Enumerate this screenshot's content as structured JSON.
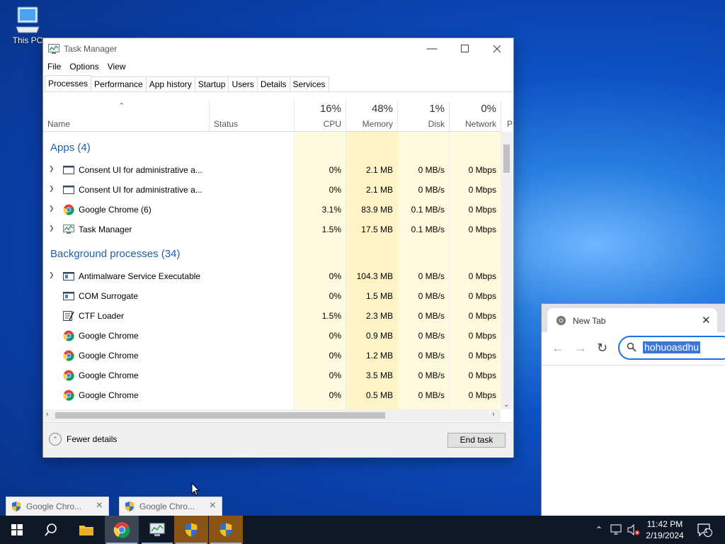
{
  "desktop": {
    "this_pc_label": "This PC"
  },
  "task_manager": {
    "title": "Task Manager",
    "menu": [
      "File",
      "Options",
      "View"
    ],
    "tabs": [
      "Processes",
      "Performance",
      "App history",
      "Startup",
      "Users",
      "Details",
      "Services"
    ],
    "columns": {
      "name": "Name",
      "status": "Status",
      "cpu": {
        "pct": "16%",
        "label": "CPU"
      },
      "memory": {
        "pct": "48%",
        "label": "Memory"
      },
      "disk": {
        "pct": "1%",
        "label": "Disk"
      },
      "network": {
        "pct": "0%",
        "label": "Network"
      },
      "power_partial": "P"
    },
    "groups": {
      "apps": "Apps (4)",
      "background": "Background processes (34)"
    },
    "apps": [
      {
        "name": "Consent UI for administrative a...",
        "cpu": "0%",
        "memory": "2.1 MB",
        "disk": "0 MB/s",
        "network": "0 Mbps",
        "icon": "window-icon"
      },
      {
        "name": "Consent UI for administrative a...",
        "cpu": "0%",
        "memory": "2.1 MB",
        "disk": "0 MB/s",
        "network": "0 Mbps",
        "icon": "window-icon"
      },
      {
        "name": "Google Chrome (6)",
        "cpu": "3.1%",
        "memory": "83.9 MB",
        "disk": "0.1 MB/s",
        "network": "0 Mbps",
        "icon": "chrome-icon"
      },
      {
        "name": "Task Manager",
        "cpu": "1.5%",
        "memory": "17.5 MB",
        "disk": "0.1 MB/s",
        "network": "0 Mbps",
        "icon": "task-manager-icon"
      }
    ],
    "background": [
      {
        "name": "Antimalware Service Executable",
        "cpu": "0%",
        "memory": "104.3 MB",
        "disk": "0 MB/s",
        "network": "0 Mbps",
        "icon": "service-icon",
        "expandable": true
      },
      {
        "name": "COM Surrogate",
        "cpu": "0%",
        "memory": "1.5 MB",
        "disk": "0 MB/s",
        "network": "0 Mbps",
        "icon": "service-icon"
      },
      {
        "name": "CTF Loader",
        "cpu": "1.5%",
        "memory": "2.3 MB",
        "disk": "0 MB/s",
        "network": "0 Mbps",
        "icon": "ctf-icon"
      },
      {
        "name": "Google Chrome",
        "cpu": "0%",
        "memory": "0.9 MB",
        "disk": "0 MB/s",
        "network": "0 Mbps",
        "icon": "chrome-icon"
      },
      {
        "name": "Google Chrome",
        "cpu": "0%",
        "memory": "1.2 MB",
        "disk": "0 MB/s",
        "network": "0 Mbps",
        "icon": "chrome-icon"
      },
      {
        "name": "Google Chrome",
        "cpu": "0%",
        "memory": "3.5 MB",
        "disk": "0 MB/s",
        "network": "0 Mbps",
        "icon": "chrome-icon"
      },
      {
        "name": "Google Chrome",
        "cpu": "0%",
        "memory": "0.5 MB",
        "disk": "0 MB/s",
        "network": "0 Mbps",
        "icon": "chrome-icon"
      }
    ],
    "footer": {
      "fewer_details": "Fewer details",
      "end_task": "End task"
    }
  },
  "chrome": {
    "tab_title": "New Tab",
    "omnibox_text": "hohuoasdhu"
  },
  "notifications": [
    {
      "label": "Google Chro..."
    },
    {
      "label": "Google Chro..."
    }
  ],
  "taskbar": {
    "clock_time": "11:42 PM",
    "clock_date": "2/19/2024",
    "notification_count": "1"
  },
  "colors": {
    "heat_light": "#fff9dd",
    "heat_mid": "#fff0b8",
    "group_blue": "#1f5fad",
    "accent": "#1a73e8"
  }
}
